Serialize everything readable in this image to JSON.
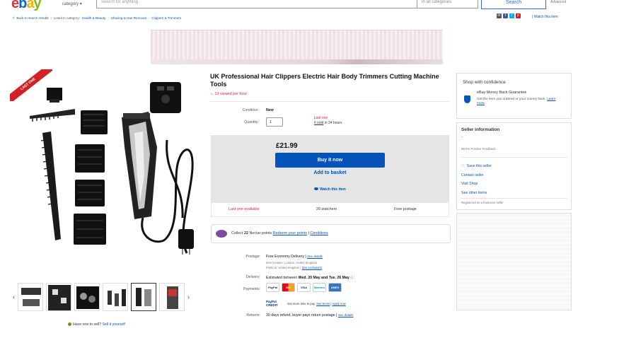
{
  "header": {
    "logo_e": "e",
    "logo_b": "b",
    "logo_a": "a",
    "logo_y": "y",
    "category_label": "category",
    "search_placeholder": "Search for anything",
    "category_select": "In all categories",
    "search_button": "Search",
    "advanced": "Advanced"
  },
  "breadcrumbs": {
    "back": "Back to search results",
    "listed_in": "Listed in category:",
    "items": [
      "Health & Beauty",
      "Shaving & Hair Removal",
      "Clippers & Trimmers"
    ]
  },
  "share": {
    "watch_link": "Watch this item"
  },
  "gallery": {
    "ribbon": "LAST ONE"
  },
  "sell_one": {
    "text": "Have one to sell?",
    "link": "Sell it yourself"
  },
  "listing": {
    "title": "UK Professional Hair Clippers Electric Hair Body Trimmers Cutting Machine Tools",
    "viewed": "13 viewed per hour",
    "condition_label": "Condition:",
    "condition": "New",
    "quantity_label": "Quantity:",
    "quantity": "1",
    "last_one": "Last one",
    "sold": "6 sold",
    "sold_suffix": "in 24 hours",
    "price": "£21.99",
    "buy_now": "Buy it now",
    "add_to_basket": "Add to basket",
    "watch": "Watch this item",
    "stat_last": "Last one available",
    "stat_watchers": "26 watchers",
    "stat_postage": "Free postage"
  },
  "nectar": {
    "prefix": "Collect",
    "points": "22",
    "suffix": "Nectar points",
    "redeem": "Redeem your points",
    "conditions": "Conditions"
  },
  "shipping": {
    "postage_label": "Postage:",
    "postage": "Free Economy Delivery",
    "postage_link": "See details",
    "item_location": "Item location: London, United Kingdom",
    "posts_to": "Posts to: United Kingdom",
    "exclusions": "See exclusions",
    "delivery_label": "Delivery:",
    "delivery_prefix": "Estimated between",
    "delivery_dates": "Wed. 20 May and Tue. 26 May",
    "payments_label": "Payments:",
    "pay_icons": [
      "PayPal",
      "MC",
      "VISA",
      "Maestro",
      "AMEX"
    ],
    "paypal_credit": "PayPal CREDIT",
    "credit_text": "Get more time to pay.",
    "credit_link": "See terms",
    "apply_link": "Apply now",
    "returns_label": "Returns:",
    "returns": "30 days refund, buyer pays return postage",
    "returns_link": "See details"
  },
  "confidence": {
    "title": "Shop with confidence",
    "guarantee": "eBay Money Back Guarantee",
    "desc": "Get the item you ordered or your money back.",
    "learn": "Learn more"
  },
  "seller": {
    "title": "Seller information",
    "name": "-",
    "feedback": "99.6% Positive Feedback",
    "save": "Save this seller",
    "contact": "Contact seller",
    "shop": "Visit Shop",
    "other": "See other items",
    "business": "Registered as a business seller"
  },
  "colors": {
    "accent": "#0654ba",
    "alert": "#dd1e31",
    "ribbon": "#d12127"
  }
}
